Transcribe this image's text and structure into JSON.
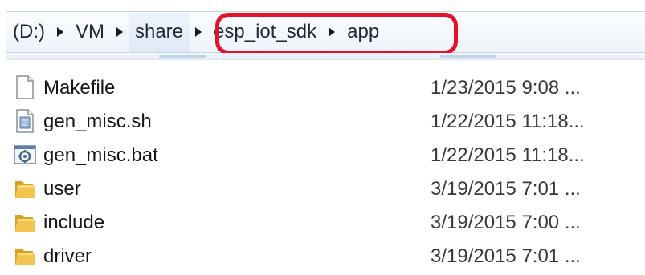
{
  "breadcrumb": {
    "items": [
      {
        "label": "(D:)",
        "highlighted": false
      },
      {
        "label": "VM",
        "highlighted": false
      },
      {
        "label": "share",
        "highlighted": true
      },
      {
        "label": "esp_iot_sdk",
        "highlighted": false
      },
      {
        "label": "app",
        "highlighted": false
      }
    ]
  },
  "annotation": {
    "color": "#e8102a",
    "target": "esp_iot_sdk > app"
  },
  "files": [
    {
      "name": "Makefile",
      "date": "1/23/2015 9:08 ...",
      "icon": "blank-file-icon"
    },
    {
      "name": "gen_misc.sh",
      "date": "1/22/2015 11:18...",
      "icon": "script-file-icon"
    },
    {
      "name": "gen_misc.bat",
      "date": "1/22/2015 11:18...",
      "icon": "batch-file-icon"
    },
    {
      "name": "user",
      "date": "3/19/2015 7:01 ...",
      "icon": "folder-icon"
    },
    {
      "name": "include",
      "date": "3/19/2015 7:00 ...",
      "icon": "folder-icon"
    },
    {
      "name": "driver",
      "date": "3/19/2015 7:01 ...",
      "icon": "folder-icon"
    }
  ]
}
